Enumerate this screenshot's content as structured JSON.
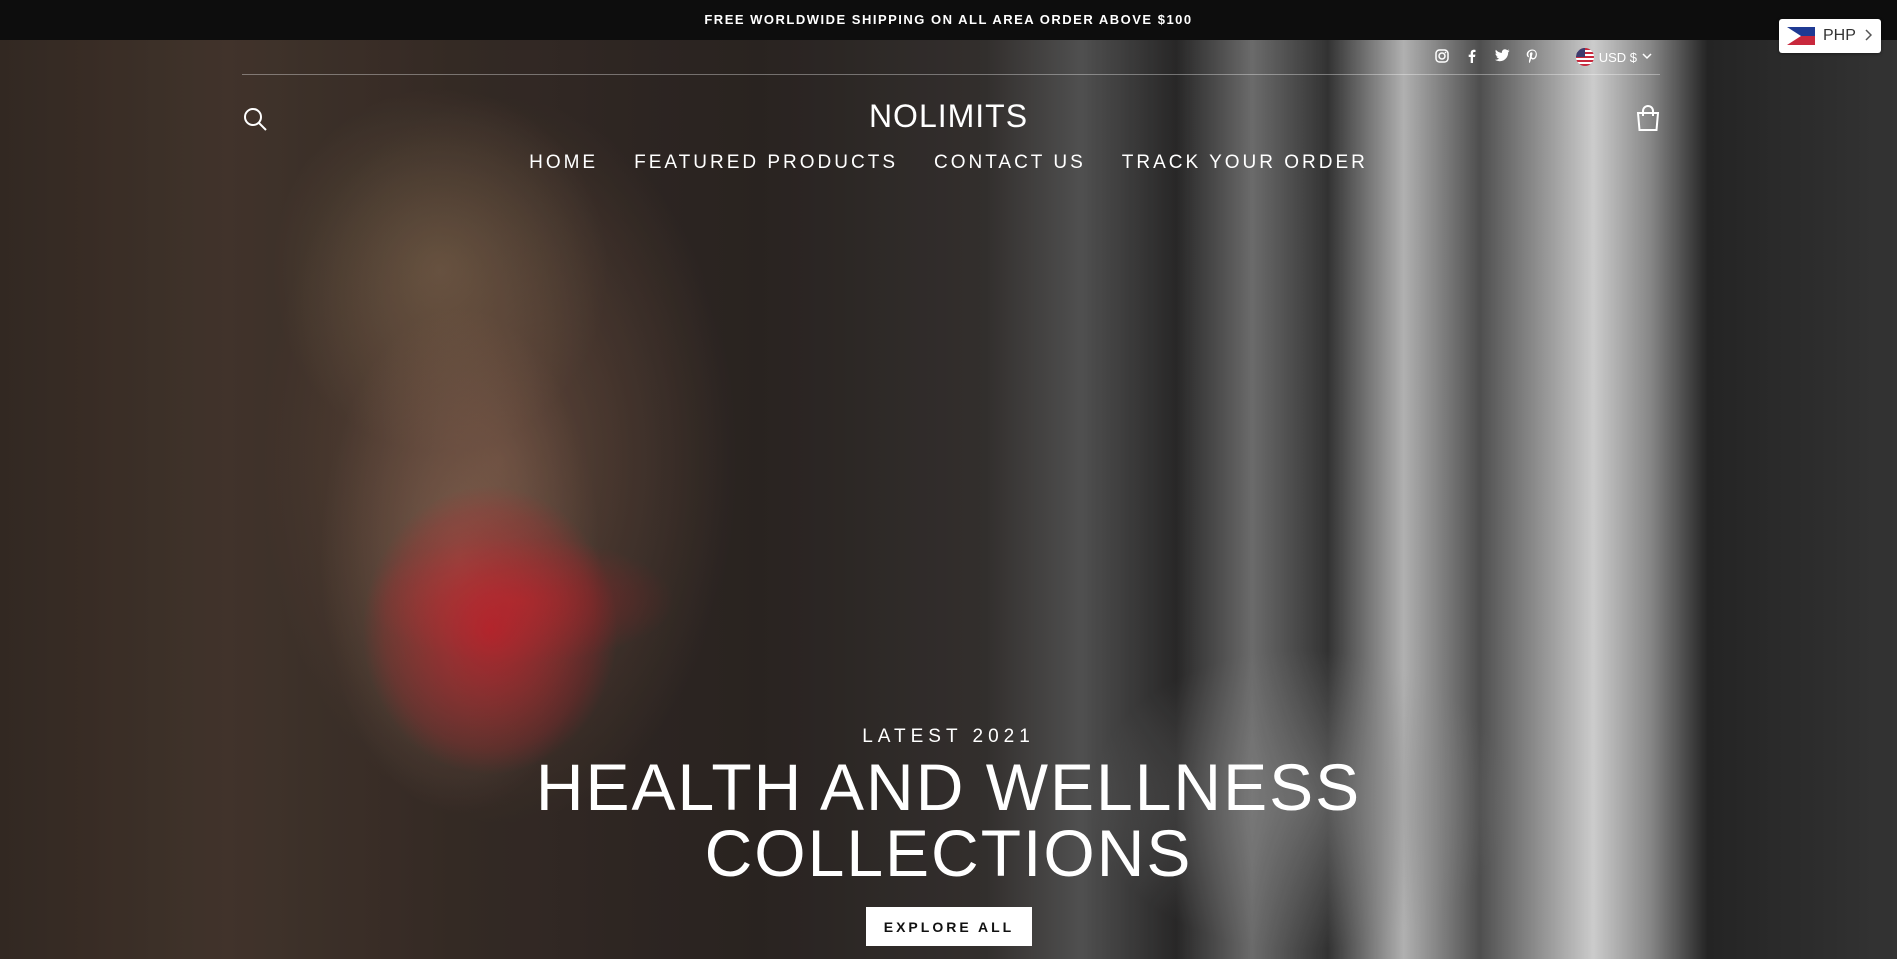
{
  "announcement": {
    "text": "FREE WORLDWIDE SHIPPING ON ALL AREA ORDER ABOVE $100"
  },
  "social": [
    "instagram-icon",
    "facebook-icon",
    "twitter-icon",
    "pinterest-icon"
  ],
  "currency": {
    "label": "USD $"
  },
  "header": {
    "brand": "NOLIMITS"
  },
  "nav": [
    "HOME",
    "FEATURED PRODUCTS",
    "CONTACT US",
    "TRACK YOUR ORDER"
  ],
  "hero": {
    "eyebrow": "LATEST 2021",
    "headline_line1": "HEALTH AND WELLNESS",
    "headline_line2": "COLLECTIONS",
    "cta": "EXPLORE ALL"
  },
  "currency_switcher": {
    "label": "PHP"
  },
  "colors": {
    "announcement_bg": "#0d0d0d",
    "text_light": "#ffffff",
    "button_bg": "#ffffff"
  }
}
